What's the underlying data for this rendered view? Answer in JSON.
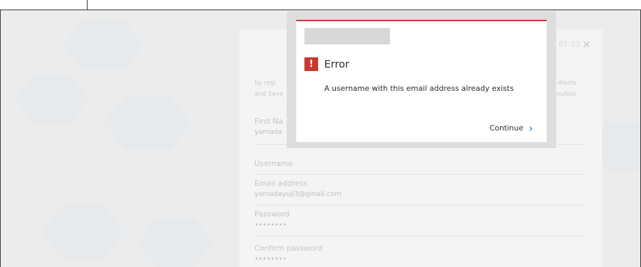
{
  "dialog": {
    "title": "Error",
    "message": "A username with this email address already exists",
    "continue_label": "Continue",
    "badge": "!",
    "chevron": "›"
  },
  "form": {
    "timer": "85:33",
    "close": "×",
    "intro_left_1": "by regi",
    "intro_left_2": "and Save",
    "intro_right_1": "e Alerts",
    "intro_right_2": "minutes)",
    "first_name_label": "First Na",
    "first_name_value": "yamada",
    "username_label": "Username",
    "email_label": "Email address",
    "email_value": "yamadayuji3@gmail.com",
    "password_label": "Password",
    "password_value": "••••••••",
    "confirm_label": "Confirm password",
    "confirm_value": "••••••••"
  },
  "colors": {
    "accent": "#c9372c",
    "link": "#1f6fa8",
    "text": "#2c2c2c"
  }
}
